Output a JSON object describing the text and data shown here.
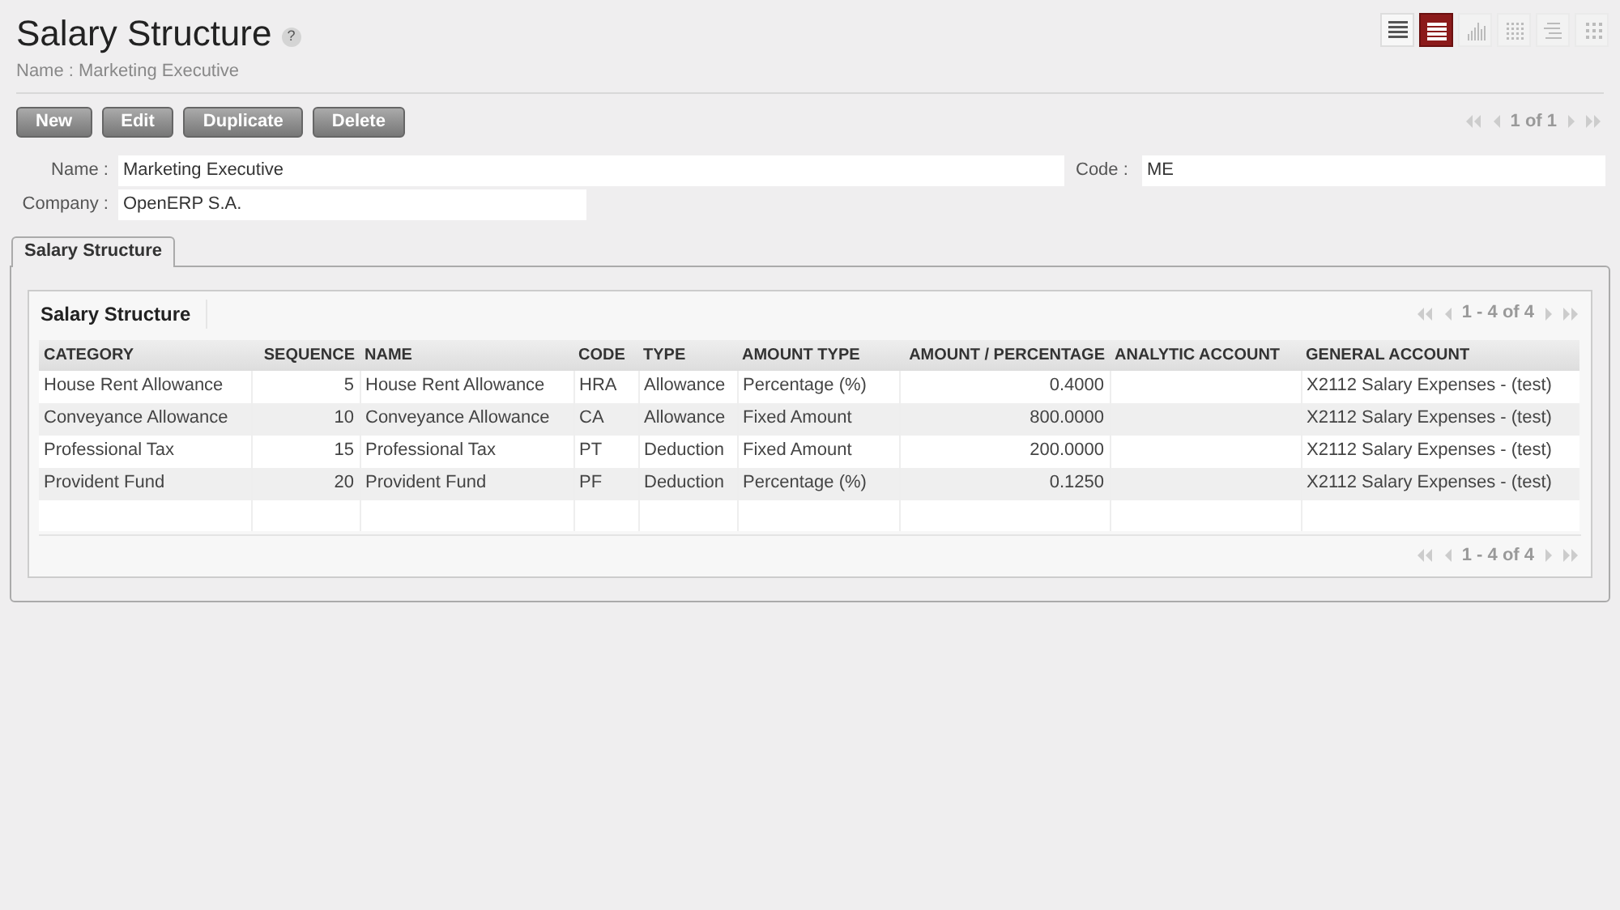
{
  "header": {
    "title": "Salary Structure",
    "help": "?",
    "subtitle": "Name : Marketing Executive"
  },
  "views": [
    {
      "kind": "list",
      "selected": false
    },
    {
      "kind": "form",
      "selected": true
    },
    {
      "kind": "graph",
      "selected": false
    },
    {
      "kind": "calendar",
      "selected": false
    },
    {
      "kind": "gantt",
      "selected": false
    },
    {
      "kind": "kanban",
      "selected": false
    }
  ],
  "buttons": [
    "New",
    "Edit",
    "Duplicate",
    "Delete"
  ],
  "pager": "1 of 1",
  "fields": {
    "name": {
      "label": "Name :",
      "value": "Marketing Executive"
    },
    "code": {
      "label": "Code :",
      "value": "ME"
    },
    "company": {
      "label": "Company :",
      "value": "OpenERP S.A."
    }
  },
  "tabs": [
    {
      "label": "Salary Structure",
      "selected": true
    }
  ],
  "grid": {
    "title": "Salary Structure",
    "pager_top": "1 - 4 of 4",
    "pager_bottom": "1 - 4 of 4",
    "columns": [
      "CATEGORY",
      "SEQUENCE",
      "NAME",
      "CODE",
      "TYPE",
      "AMOUNT TYPE",
      "AMOUNT / PERCENTAGE",
      "ANALYTIC ACCOUNT",
      "GENERAL ACCOUNT"
    ],
    "rows": [
      [
        "House Rent Allowance",
        "5",
        "House Rent Allowance",
        "HRA",
        "Allowance",
        "Percentage (%)",
        "0.4000",
        "",
        "X2112 Salary Expenses - (test)"
      ],
      [
        "Conveyance Allowance",
        "10",
        "Conveyance Allowance",
        "CA",
        "Allowance",
        "Fixed Amount",
        "800.0000",
        "",
        "X2112 Salary Expenses - (test)"
      ],
      [
        "Professional Tax",
        "15",
        "Professional Tax",
        "PT",
        "Deduction",
        "Fixed Amount",
        "200.0000",
        "",
        "X2112 Salary Expenses - (test)"
      ],
      [
        "Provident Fund",
        "20",
        "Provident Fund",
        "PF",
        "Deduction",
        "Percentage (%)",
        "0.1250",
        "",
        "X2112 Salary Expenses - (test)"
      ]
    ]
  }
}
